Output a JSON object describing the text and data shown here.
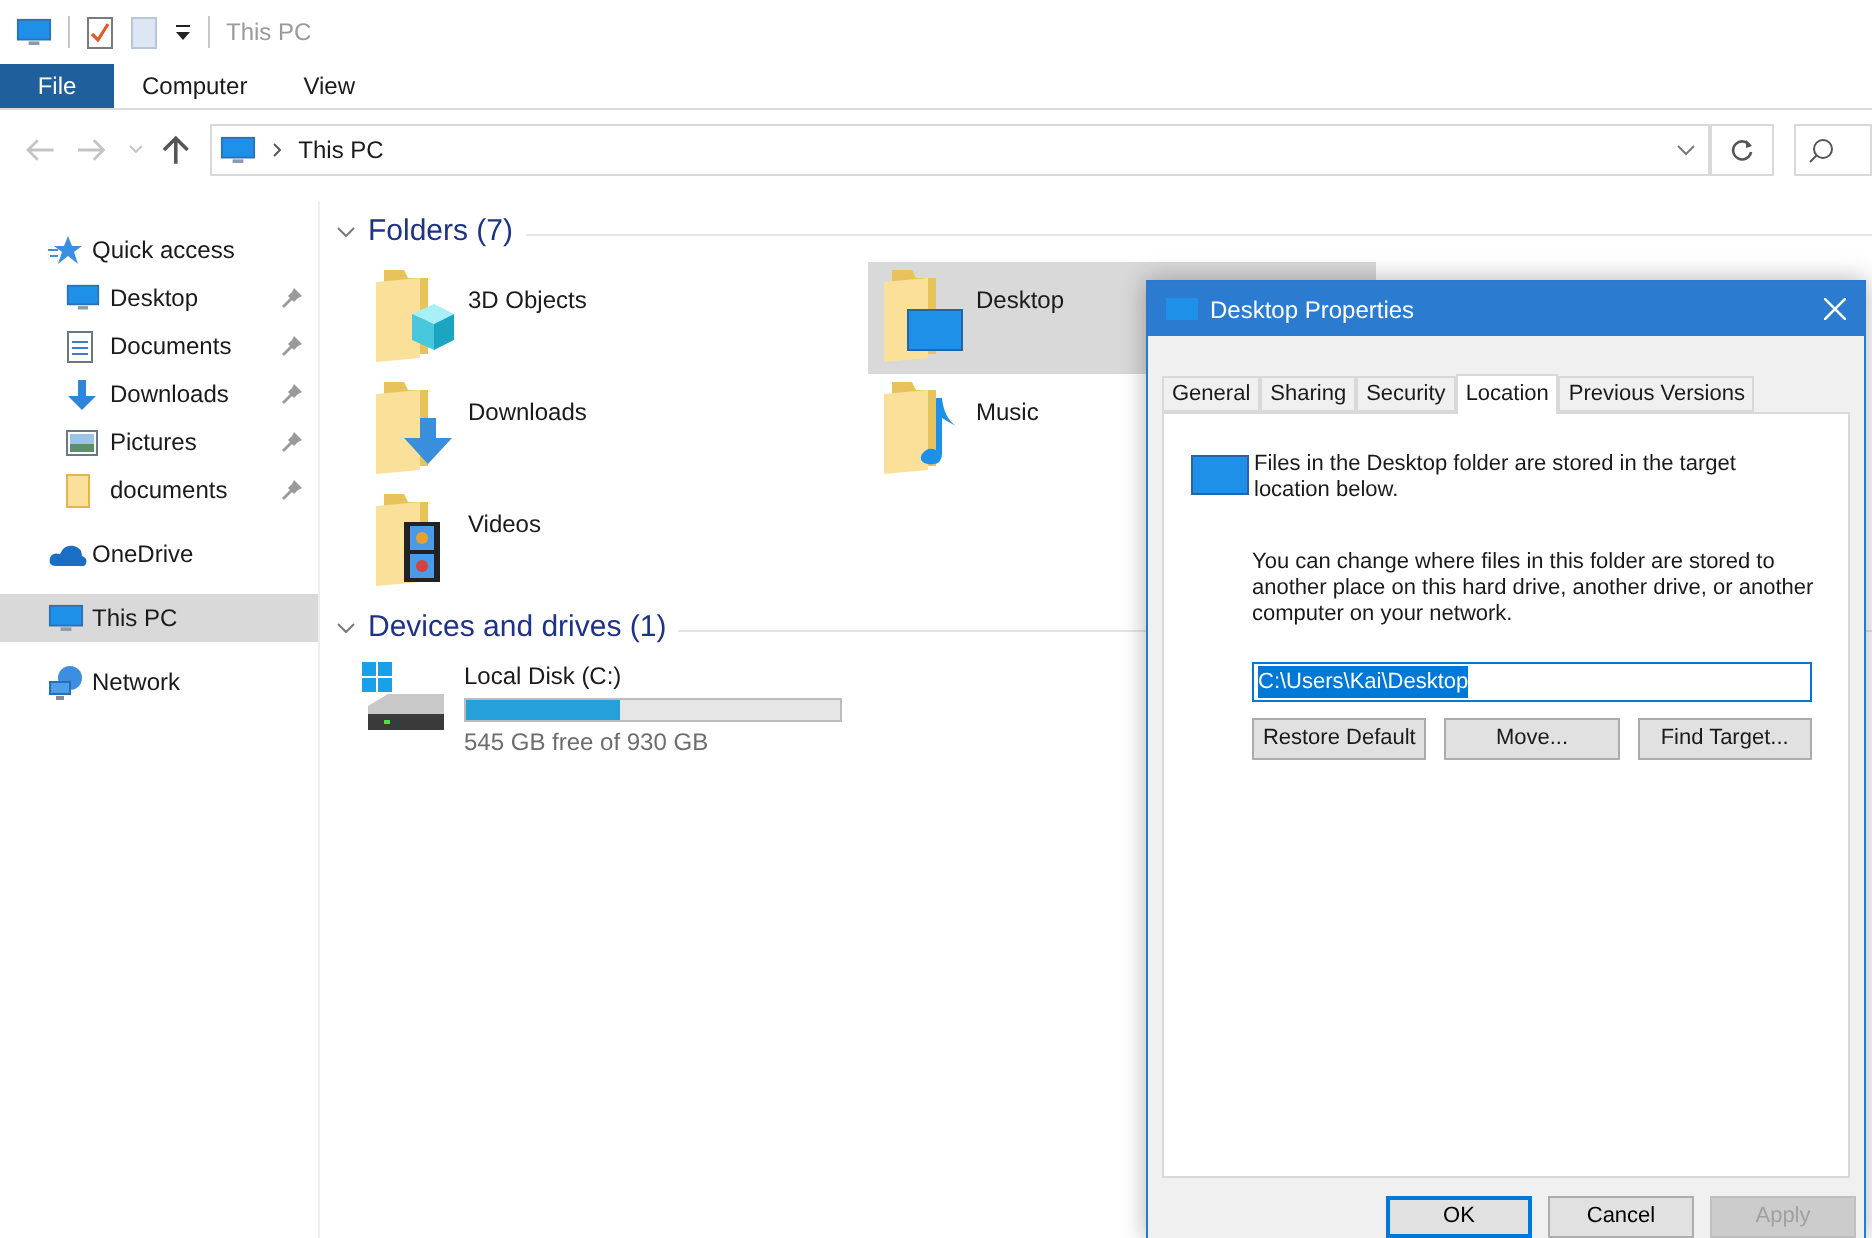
{
  "title_bar": {
    "title": "This PC"
  },
  "ribbon": {
    "file_tab": "File",
    "tabs": [
      {
        "label": "Computer"
      },
      {
        "label": "View"
      }
    ]
  },
  "address_bar": {
    "path": "This PC"
  },
  "sidebar": {
    "items": [
      {
        "label": "Quick access",
        "selected": false,
        "children": [
          {
            "label": "Desktop",
            "pinned": true,
            "selected": false
          },
          {
            "label": "Documents",
            "pinned": true,
            "selected": false
          },
          {
            "label": "Downloads",
            "pinned": true,
            "selected": false
          },
          {
            "label": "Pictures",
            "pinned": true,
            "selected": false
          },
          {
            "label": "documents",
            "pinned": true,
            "selected": false
          }
        ]
      },
      {
        "label": "OneDrive",
        "selected": false
      },
      {
        "label": "This PC",
        "selected": true
      },
      {
        "label": "Network",
        "selected": false
      }
    ]
  },
  "folders": {
    "heading": "Folders (7)",
    "items": [
      {
        "name": "3D Objects",
        "selected": false
      },
      {
        "name": "Desktop",
        "selected": true
      },
      {
        "name": "Downloads",
        "selected": false
      },
      {
        "name": "Music",
        "selected": false
      },
      {
        "name": "Videos",
        "selected": false
      }
    ]
  },
  "drives": {
    "heading": "Devices and drives (1)",
    "items": [
      {
        "name": "Local Disk (C:)",
        "level": 0.414,
        "free": "545 GB free of 930 GB"
      }
    ]
  },
  "dialog": {
    "title": "Desktop Properties",
    "tabs": [
      {
        "label": "General",
        "selected": false
      },
      {
        "label": "Sharing",
        "selected": false
      },
      {
        "label": "Security",
        "selected": false
      },
      {
        "label": "Location",
        "selected": true
      },
      {
        "label": "Previous Versions",
        "selected": false
      }
    ],
    "intro": "Files in the Desktop folder are stored in the target location below.",
    "description": "You can change where files in this folder are stored to another place on this hard drive, another drive, or another computer on your network.",
    "path": {
      "value": "C:\\Users\\Kai\\Desktop",
      "text_selected": true
    },
    "path_buttons": [
      "Restore Default",
      "Move...",
      "Find Target..."
    ],
    "buttons": [
      {
        "label": "OK",
        "default": true,
        "disabled": false
      },
      {
        "label": "Cancel",
        "default": false,
        "disabled": false
      },
      {
        "label": "Apply",
        "default": false,
        "disabled": true
      }
    ]
  }
}
